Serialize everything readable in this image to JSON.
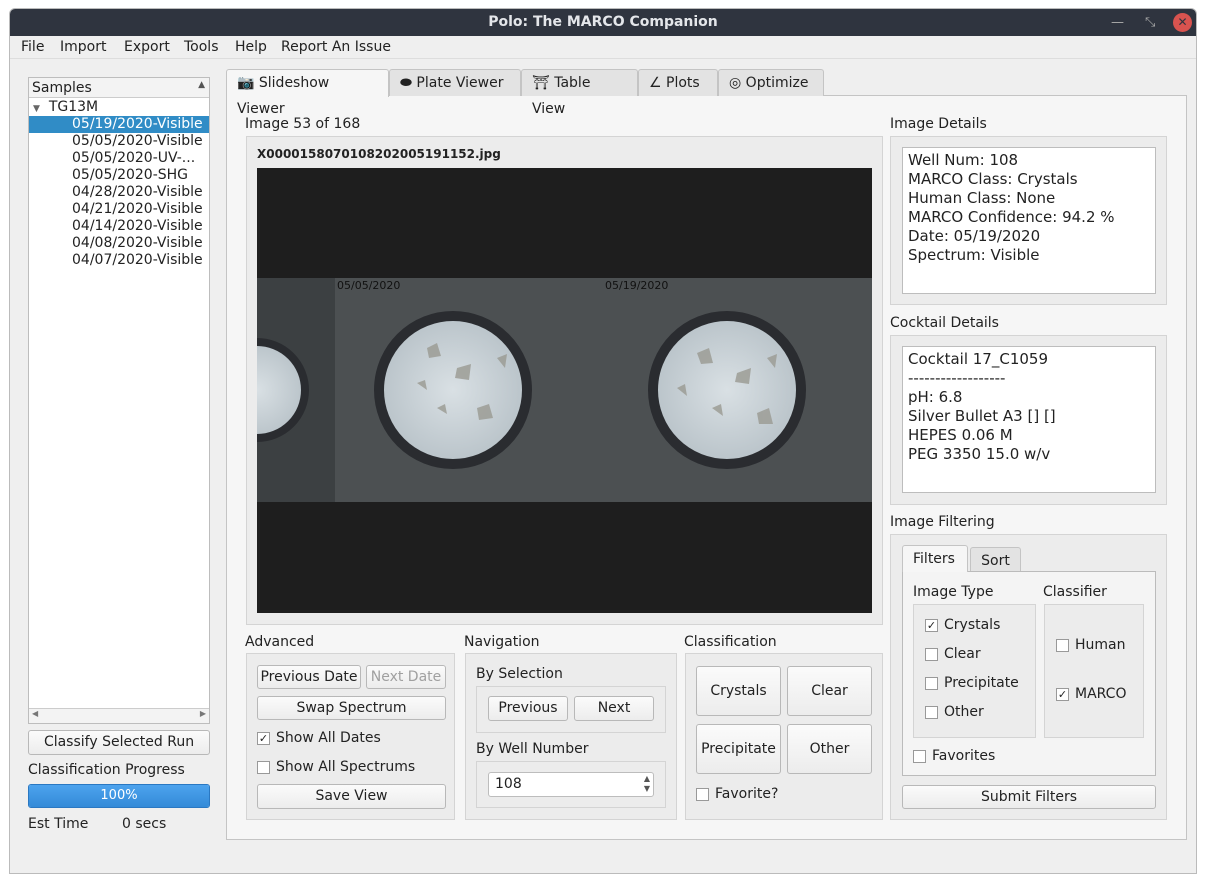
{
  "window": {
    "title": "Polo: The MARCO Companion"
  },
  "menu": [
    "File",
    "Import",
    "Export",
    "Tools",
    "Help",
    "Report An Issue"
  ],
  "samples": {
    "header": "Samples",
    "root": "TG13M",
    "runs": [
      "05/19/2020-Visible",
      "05/05/2020-Visible",
      "05/05/2020-UV-...",
      "05/05/2020-SHG",
      "04/28/2020-Visible",
      "04/21/2020-Visible",
      "04/14/2020-Visible",
      "04/08/2020-Visible",
      "04/07/2020-Visible"
    ],
    "selected_index": 0
  },
  "left": {
    "classify_button": "Classify Selected Run",
    "progress_label": "Classification Progress",
    "progress_value": 100,
    "progress_text": "100%",
    "est_time_label": "Est Time",
    "est_time_value": "0 secs"
  },
  "tabs": [
    {
      "label": "Slideshow Viewer",
      "icon": "camera-icon"
    },
    {
      "label": "Plate Viewer",
      "icon": "eye-icon"
    },
    {
      "label": "Table View",
      "icon": "table-icon"
    },
    {
      "label": "Plots",
      "icon": "plot-icon"
    },
    {
      "label": "Optimize",
      "icon": "target-icon"
    }
  ],
  "viewer": {
    "counter": "Image 53 of 168",
    "filename": "X0000158070108202005191152.jpg",
    "dates": [
      "05/05/2020",
      "05/19/2020"
    ]
  },
  "image_details": {
    "label": "Image Details",
    "lines": [
      "Well Num: 108",
      "MARCO Class: Crystals",
      "Human Class: None",
      "MARCO Confidence: 94.2 %",
      "Date: 05/19/2020",
      "Spectrum: Visible"
    ]
  },
  "cocktail": {
    "label": "Cocktail Details",
    "lines": [
      "Cocktail 17_C1059",
      "------------------",
      "pH: 6.8",
      "Silver Bullet A3 [] []",
      "HEPES 0.06 M",
      "PEG 3350 15.0 w/v"
    ]
  },
  "filtering": {
    "label": "Image Filtering",
    "tabs": [
      "Filters",
      "Sort"
    ],
    "image_type_label": "Image Type",
    "image_types": [
      {
        "label": "Crystals",
        "checked": true
      },
      {
        "label": "Clear",
        "checked": false
      },
      {
        "label": "Precipitate",
        "checked": false
      },
      {
        "label": "Other",
        "checked": false
      }
    ],
    "classifier_label": "Classifier",
    "classifiers": [
      {
        "label": "Human",
        "checked": false
      },
      {
        "label": "MARCO",
        "checked": true
      }
    ],
    "favorites": "Favorites",
    "submit": "Submit Filters"
  },
  "advanced": {
    "label": "Advanced",
    "prev_date": "Previous Date",
    "next_date": "Next Date",
    "swap": "Swap Spectrum",
    "show_all_dates": "Show All Dates",
    "show_all_spectrums": "Show All Spectrums",
    "save_view": "Save View"
  },
  "navigation": {
    "label": "Navigation",
    "by_selection": "By Selection",
    "previous": "Previous",
    "next": "Next",
    "by_well": "By Well Number",
    "well_value": "108"
  },
  "classification": {
    "label": "Classification",
    "buttons": [
      "Crystals",
      "Clear",
      "Precipitate",
      "Other"
    ],
    "favorite": "Favorite?"
  }
}
